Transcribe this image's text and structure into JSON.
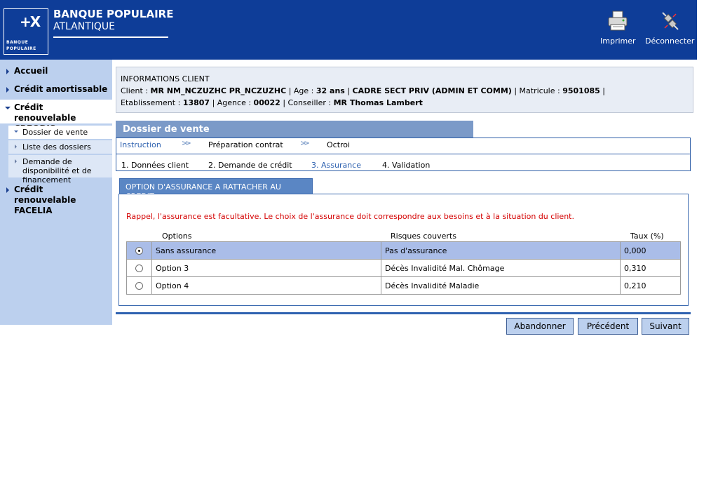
{
  "header": {
    "logo_text_top": "BANQUE",
    "logo_text_bottom": "POPULAIRE",
    "bank_name_line1": "BANQUE POPULAIRE",
    "bank_name_line2": "ATLANTIQUE",
    "print_label": "Imprimer",
    "logout_label": "Déconnecter"
  },
  "sidebar": {
    "items": [
      {
        "label": "Accueil"
      },
      {
        "label": "Crédit amortissable"
      },
      {
        "label": "Crédit renouvelable CREODIS"
      },
      {
        "label": "Crédit renouvelable FACELIA"
      }
    ],
    "sub_items": [
      {
        "label": "Dossier de vente"
      },
      {
        "label": "Liste des dossiers"
      },
      {
        "label": "Demande de disponibilité et de financement"
      }
    ]
  },
  "client_info": {
    "title": "INFORMATIONS CLIENT",
    "client_label": "Client : ",
    "client_name": "MR NM_NCZUZHC PR_NCZUZHC",
    "age_label": " | Age : ",
    "age": "32 ans",
    "profession": "CADRE SECT PRIV (ADMIN ET COMM)",
    "matricule_label": " | Matricule : ",
    "matricule": "9501085",
    "etab_label": "Etablissement : ",
    "etablissement": "13807",
    "agence_label": " | Agence : ",
    "agence": "00022",
    "conseiller_label": " | Conseiller : ",
    "conseiller": "MR Thomas Lambert"
  },
  "dossier": {
    "title": "Dossier de vente",
    "phases": [
      "Instruction",
      "Préparation contrat",
      "Octroi"
    ],
    "steps": [
      "1. Données client",
      "2. Demande de crédit",
      "3. Assurance",
      "4. Validation"
    ]
  },
  "insurance": {
    "section_title": "OPTION D'ASSURANCE A RATTACHER AU CREDIT",
    "reminder": "Rappel, l'assurance est facultative. Le choix de l'assurance doit correspondre aux besoins et à la situation du client.",
    "columns": [
      "Options",
      "Risques couverts",
      "Taux (%)"
    ],
    "rows": [
      {
        "option": "Sans assurance",
        "risks": "Pas d'assurance",
        "rate": "0,000",
        "selected": true
      },
      {
        "option": "Option 3",
        "risks": "Décès Invalidité Mal. Chômage",
        "rate": "0,310",
        "selected": false
      },
      {
        "option": "Option 4",
        "risks": "Décès Invalidité Maladie",
        "rate": "0,210",
        "selected": false
      }
    ]
  },
  "buttons": {
    "abandon": "Abandonner",
    "previous": "Précédent",
    "next": "Suivant"
  },
  "colors": {
    "header_bg": "#0e3d98",
    "sidebar_bg": "#bcd0ee",
    "accent": "#2f62b0",
    "warning_text": "#d40000"
  }
}
